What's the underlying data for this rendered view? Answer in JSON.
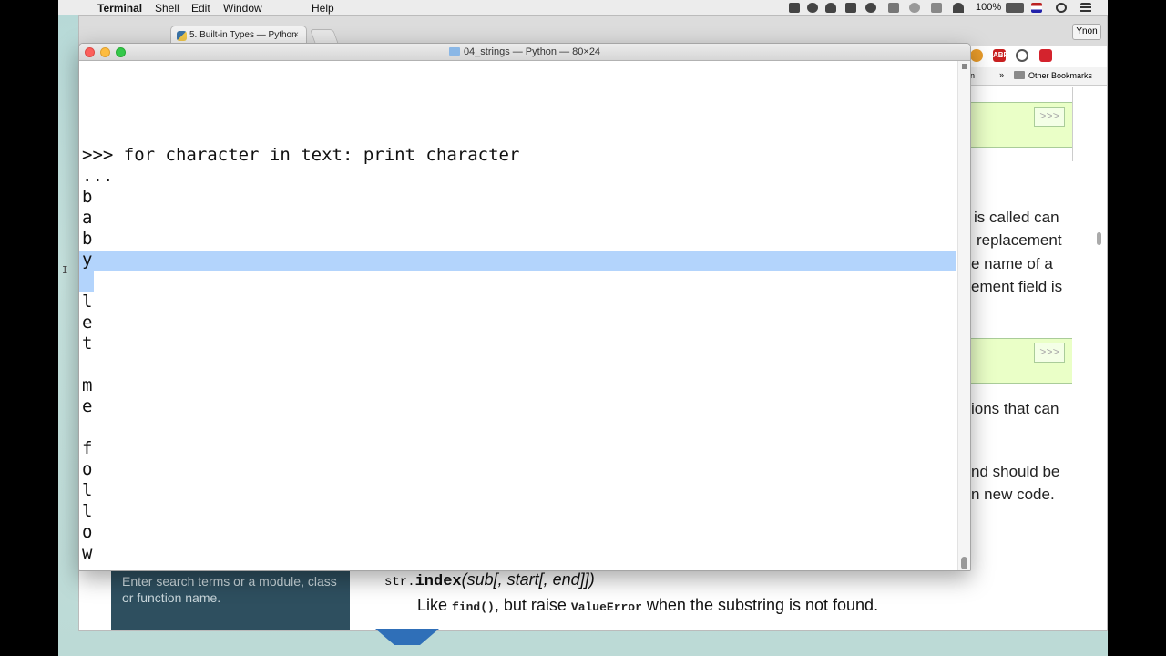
{
  "menubar": {
    "app": "Terminal",
    "items": [
      "Shell",
      "Edit",
      "Window",
      "Help"
    ],
    "battery": "100%"
  },
  "browser": {
    "tab_title": "5. Built-in Types — Python",
    "tab_close": "×",
    "user_button": "Ynon",
    "extensions": [
      "ABP"
    ],
    "bookmarks_overflow": "»",
    "other_bookmarks": "Other Bookmarks",
    "bookmark_fragment": "n",
    "prompt_button": ">>>",
    "doc_fragments": [
      "is called can",
      "replacement",
      "e name of a",
      "ement field is",
      "ions that can",
      "nd should be",
      "n new code."
    ],
    "search_placeholder": "Enter search terms or a module, class or function name.",
    "func_prefix": "str.",
    "func_name": "index",
    "func_params": "(sub[, start[, end]])",
    "desc_like": "Like ",
    "desc_find": "find()",
    "desc_mid": ", but raise ",
    "desc_error": "ValueError",
    "desc_end": " when the substring is not found."
  },
  "terminal": {
    "title": "04_strings — Python — 80×24",
    "lines": [
      ">>> for character in text: print character",
      "...",
      "b",
      "a",
      "b",
      "y",
      "",
      "l",
      "e",
      "t",
      "",
      "m",
      "e",
      "",
      "f",
      "o",
      "l",
      "l",
      "o",
      "w"
    ]
  },
  "colors": {
    "selection": "#b3d4fc",
    "close": "#fc605c",
    "minimize": "#fdbc40",
    "zoom": "#34c84a",
    "sidebar": "#2e4f5f",
    "codebox": "#eaffc7"
  }
}
